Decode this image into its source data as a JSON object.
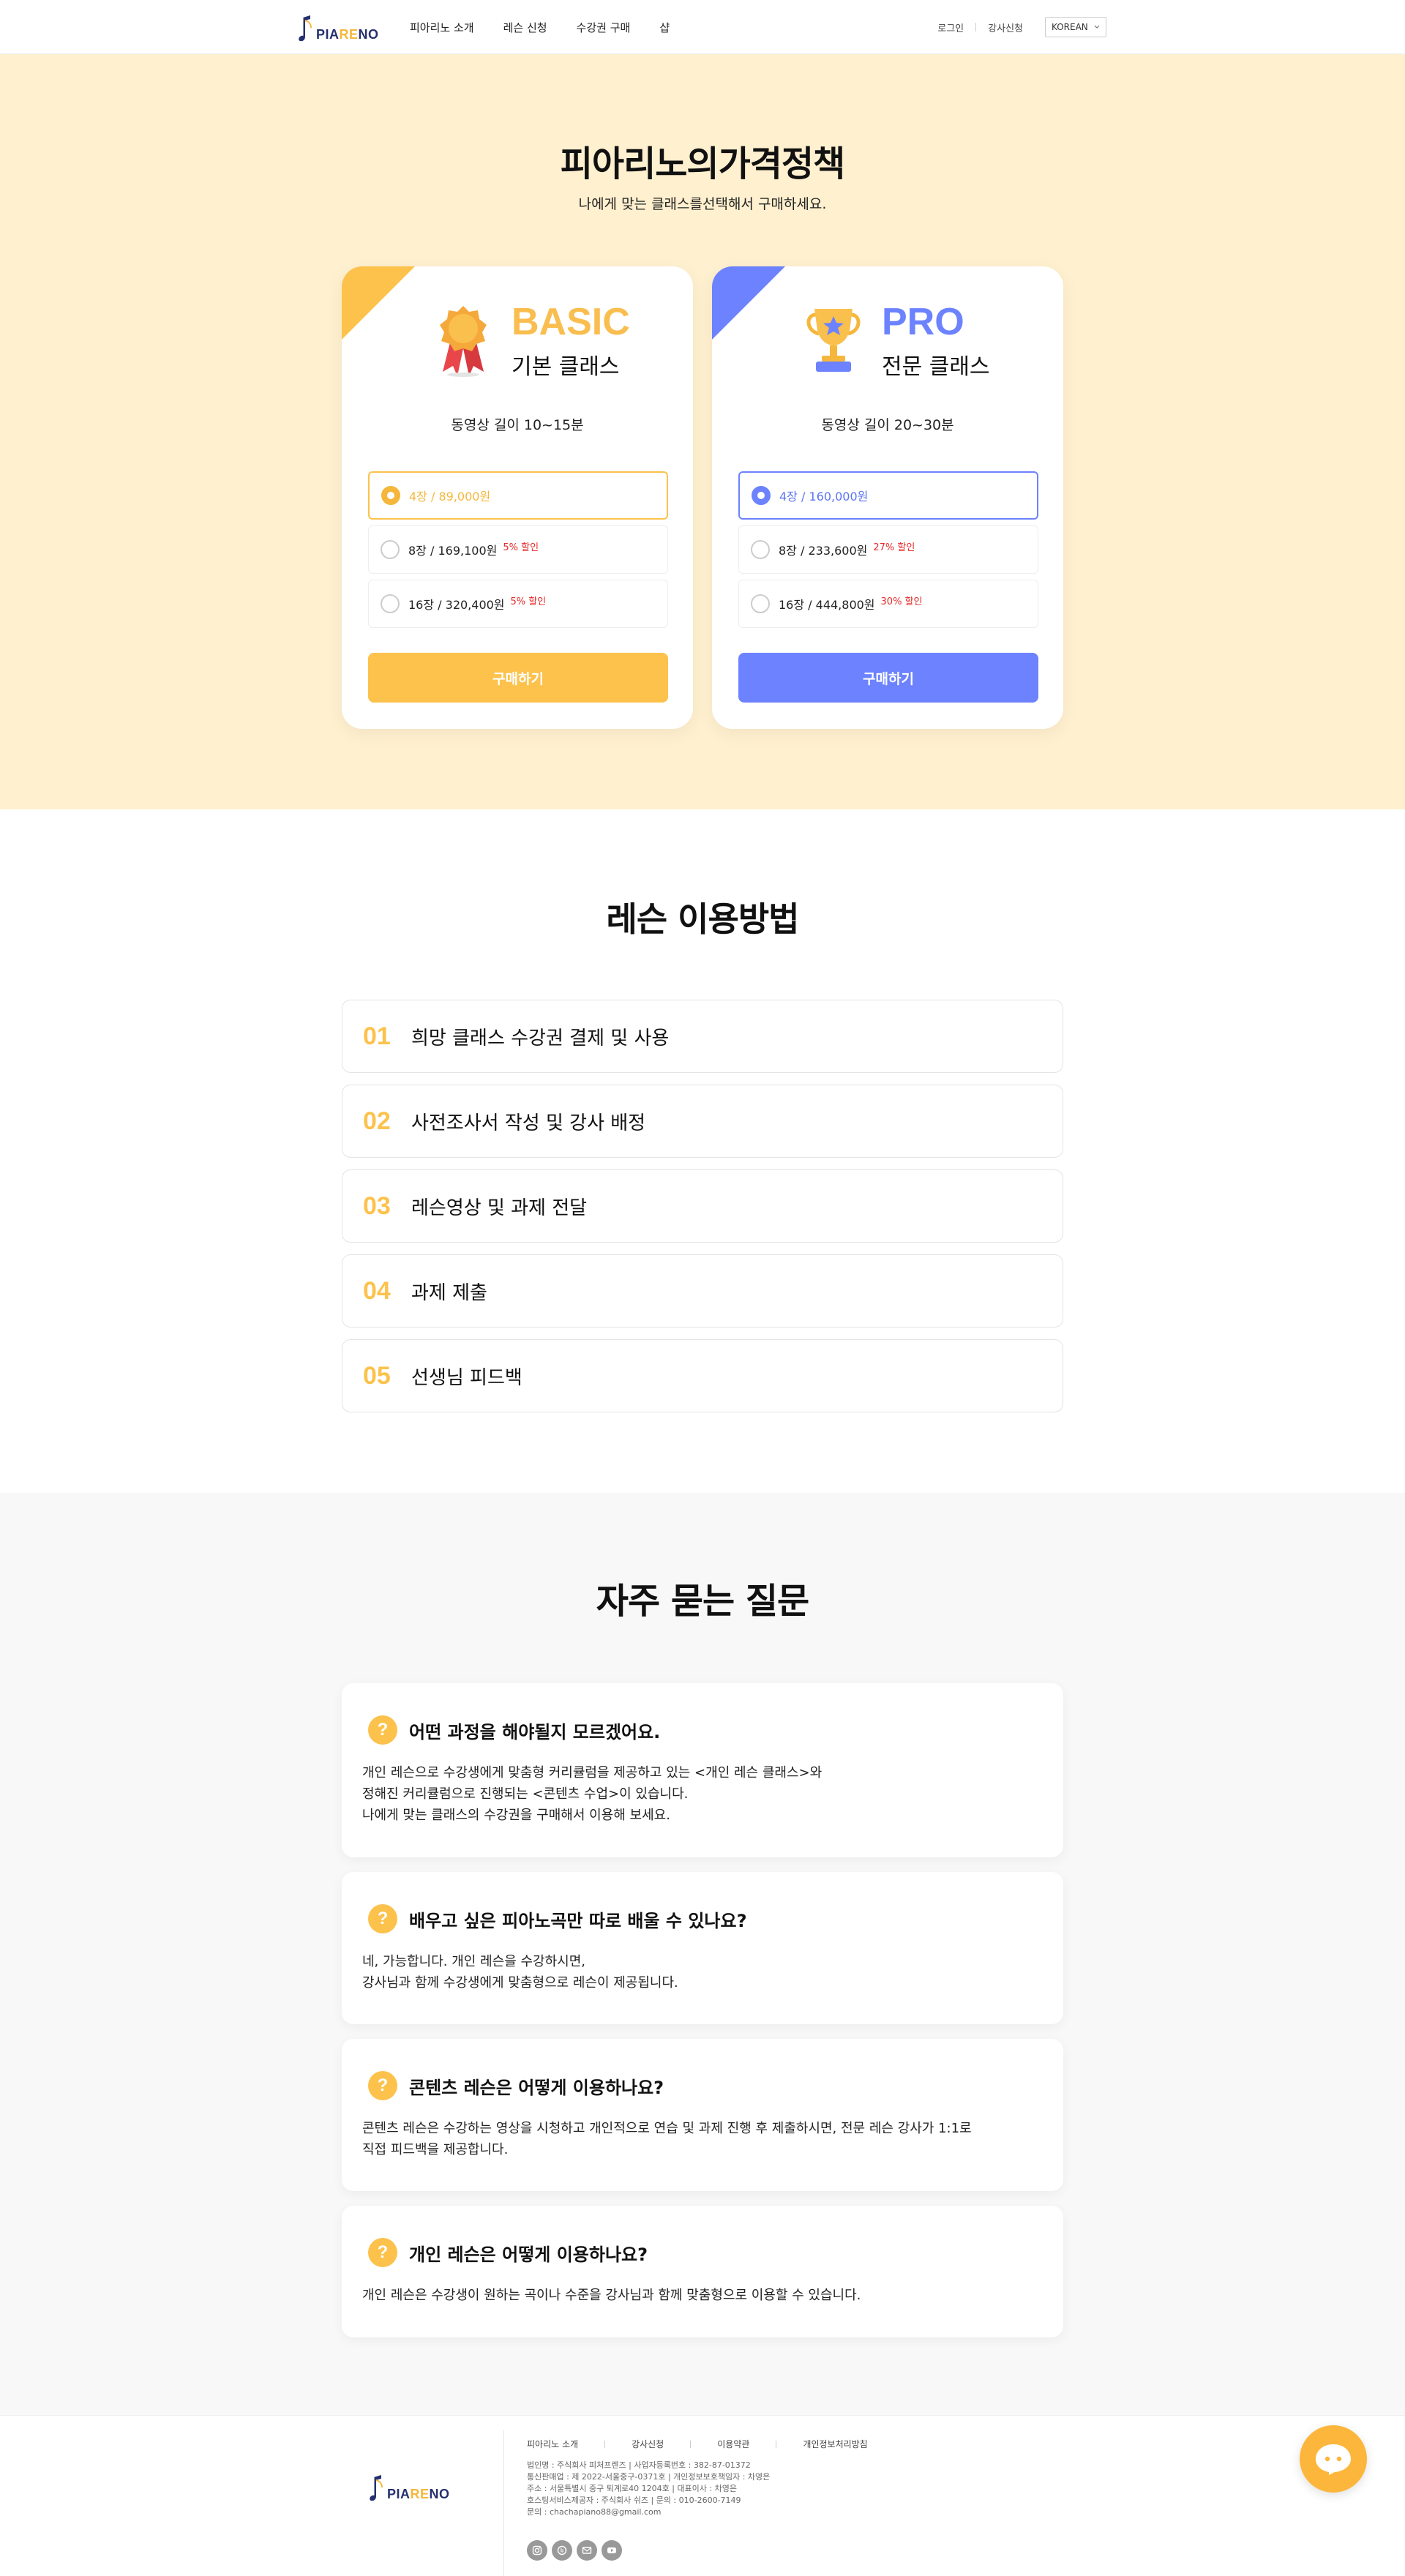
{
  "brand": {
    "logo_text_a": "PIA",
    "logo_text_b": "RE",
    "logo_text_c": "NO"
  },
  "nav": {
    "items": [
      "피아리노 소개",
      "레슨 신청",
      "수강권 구매",
      "샵"
    ]
  },
  "header_right": {
    "login": "로그인",
    "teacher_apply": "강사신청",
    "language": "KOREAN"
  },
  "pricing": {
    "title": "피아리노의가격정책",
    "subtitle": "나에게 맞는 클래스를선택해서 구매하세요.",
    "plans": [
      {
        "name": "BASIC",
        "name_kr": "기본 클래스",
        "duration": "동영상 길이 10~15분",
        "options": [
          {
            "label": "4장 / 89,000원",
            "discount": ""
          },
          {
            "label": "8장 / 169,100원",
            "discount": "5% 할인"
          },
          {
            "label": "16장 / 320,400원",
            "discount": "5% 할인"
          }
        ],
        "buy_label": "구매하기",
        "accent": "#fcc24c"
      },
      {
        "name": "PRO",
        "name_kr": "전문 클래스",
        "duration": "동영상 길이 20~30분",
        "options": [
          {
            "label": "4장 / 160,000원",
            "discount": ""
          },
          {
            "label": "8장 / 233,600원",
            "discount": "27% 할인"
          },
          {
            "label": "16장 / 444,800원",
            "discount": "30% 할인"
          }
        ],
        "buy_label": "구매하기",
        "accent": "#6c82fe"
      }
    ]
  },
  "howto": {
    "title": "레슨 이용방법",
    "steps": [
      {
        "num": "01",
        "text": "희망 클래스 수강권 결제 및 사용"
      },
      {
        "num": "02",
        "text": "사전조사서 작성 및 강사 배정"
      },
      {
        "num": "03",
        "text": "레슨영상 및 과제 전달"
      },
      {
        "num": "04",
        "text": "과제 제출"
      },
      {
        "num": "05",
        "text": "선생님 피드백"
      }
    ]
  },
  "faq": {
    "title": "자주 묻는 질문",
    "icon_char": "?",
    "items": [
      {
        "q": "어떤 과정을 해야될지 모르겠어요.",
        "a": "개인 레슨으로 수강생에게 맞춤형 커리큘럼을 제공하고 있는 <개인 레슨 클래스>와\n정해진 커리큘럼으로 진행되는 <콘텐츠 수업>이 있습니다.\n나에게 맞는 클래스의 수강권을 구매해서 이용해 보세요."
      },
      {
        "q": "배우고 싶은 피아노곡만 따로 배울 수 있나요?",
        "a": "네, 가능합니다. 개인 레슨을 수강하시면,\n강사님과 함께 수강생에게 맞춤형으로 레슨이 제공됩니다."
      },
      {
        "q": "콘텐츠 레슨은 어떻게 이용하나요?",
        "a": "콘텐츠 레슨은 수강하는 영상을 시청하고 개인적으로 연습 및 과제 진행 후 제출하시면, 전문 레슨 강사가 1:1로\n직접 피드백을 제공합니다."
      },
      {
        "q": "개인 레슨은 어떻게 이용하나요?",
        "a": "개인 레슨은 수강생이 원하는 곡이나 수준을 강사님과 함께 맞춤형으로 이용할 수 있습니다."
      }
    ]
  },
  "footer": {
    "links": [
      "피아리노 소개",
      "강사신청",
      "이용약관",
      "개인정보처리방침"
    ],
    "info": [
      "법인명 : 주식회사 피처프렌즈 | 사업자등록번호 : 382-87-01372",
      "통신판매업 : 제 2022-서울중구-0371호 | 개인정보보호책임자 : 차영은",
      "주소 : 서울특별시 중구 퇴계로40 1204호 | 대표이사 : 차영은",
      "호스팅서비스제공자 : 주식회사 쉬즈 | 문의 : 010-2600-7149",
      "문의 : chachapiano88@gmail.com"
    ]
  }
}
